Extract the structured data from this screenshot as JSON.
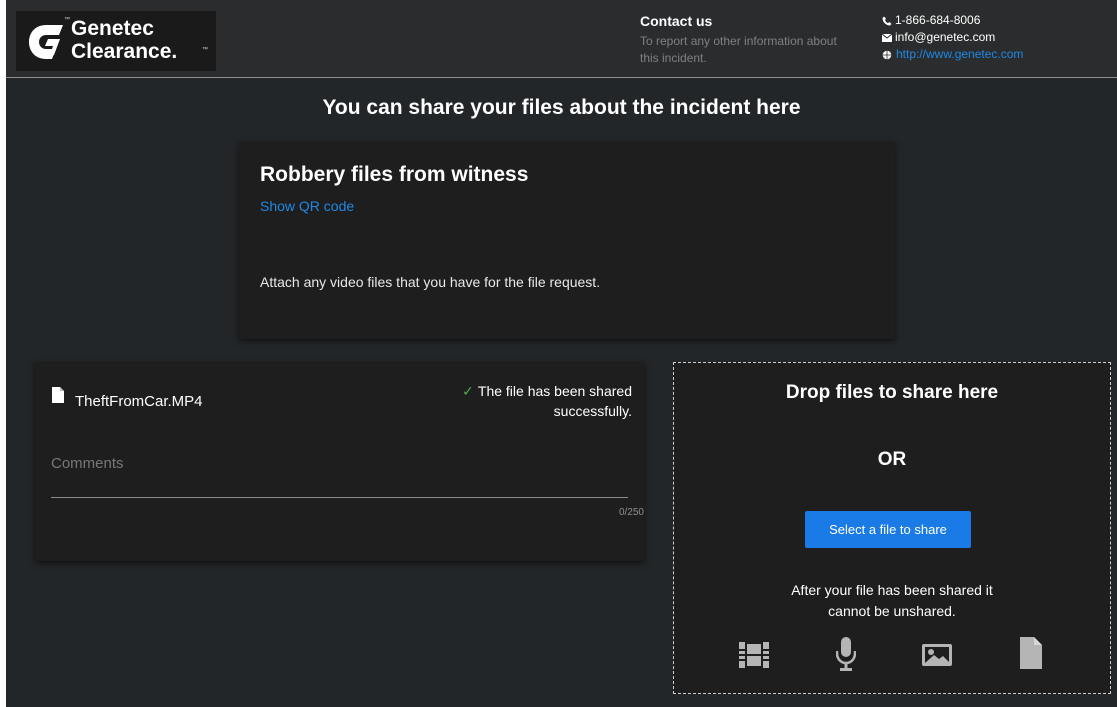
{
  "header": {
    "logo_line1": "Genetec",
    "logo_line2": "Clearance.",
    "contact_title": "Contact us",
    "contact_desc": "To report any other information about this incident.",
    "phone": "1-866-684-8006",
    "email": "info@genetec.com",
    "website": "http://www.genetec.com"
  },
  "main": {
    "title": "You can share your files about the incident here"
  },
  "request": {
    "title": "Robbery files from witness",
    "qr_link": "Show QR code",
    "description": "Attach any video files that you have for the file request."
  },
  "file": {
    "name": "TheftFromCar.MP4",
    "status": "The file has been shared successfully.",
    "comments_label": "Comments",
    "char_count": "0/250"
  },
  "dropzone": {
    "title": "Drop files to share here",
    "or": "OR",
    "button": "Select a file to share",
    "note": "After your file has been shared it cannot be unshared.",
    "icons": [
      "video-icon",
      "microphone-icon",
      "image-icon",
      "document-icon"
    ]
  },
  "colors": {
    "background": "#232628",
    "header": "#2b2c2d",
    "card": "#1e1e1e",
    "link": "#1e88e5",
    "button": "#1a7be6",
    "success": "#4caf50"
  }
}
